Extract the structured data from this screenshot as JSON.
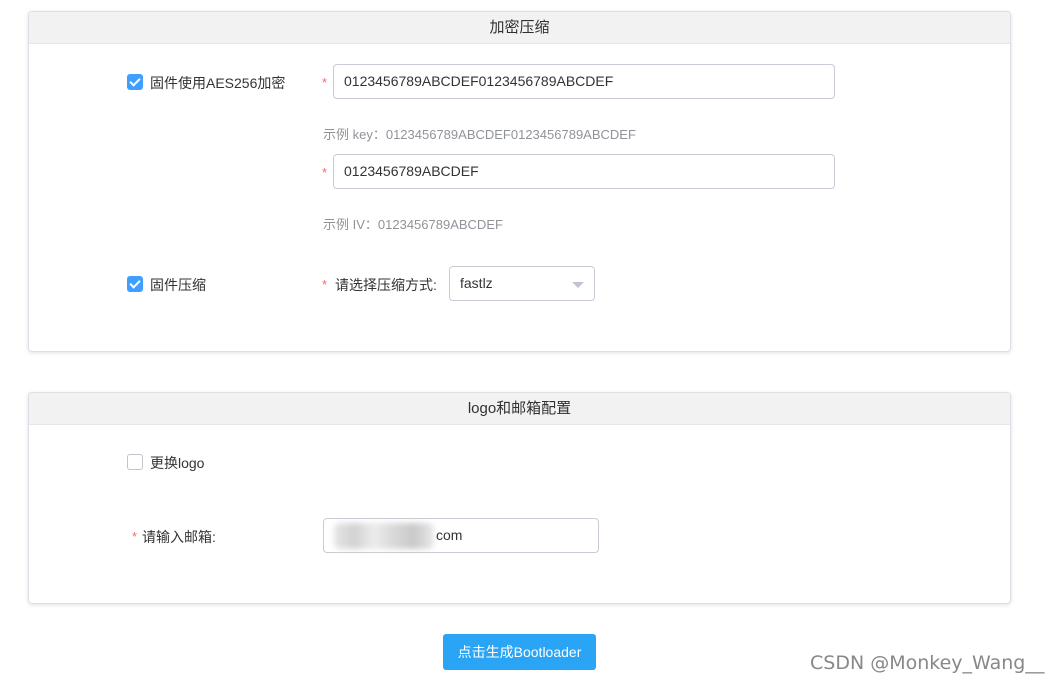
{
  "encrypt_card": {
    "title": "加密压缩",
    "aes_checkbox": {
      "label": "固件使用AES256加密",
      "checked": true
    },
    "key_input": {
      "value": "0123456789ABCDEF0123456789ABCDEF",
      "required_mark": "*"
    },
    "key_hint": "示例 key：0123456789ABCDEF0123456789ABCDEF",
    "iv_input": {
      "value": "0123456789ABCDEF",
      "required_mark": "*"
    },
    "iv_hint": "示例 IV：0123456789ABCDEF",
    "compress_checkbox": {
      "label": "固件压缩",
      "checked": true
    },
    "compress_method": {
      "required_mark": "*",
      "label": "请选择压缩方式:",
      "selected": "fastlz"
    }
  },
  "logo_card": {
    "title": "logo和邮箱配置",
    "logo_checkbox": {
      "label": "更换logo",
      "checked": false
    },
    "email": {
      "required_mark": "*",
      "label": "请输入邮箱:",
      "value_visible": "com"
    }
  },
  "generate_button": "点击生成Bootloader",
  "watermark": "CSDN @Monkey_Wang__",
  "colors": {
    "accent": "#409eff",
    "button": "#2aa4f4",
    "required": "#f56c6c",
    "header_bg": "#f2f2f2"
  }
}
